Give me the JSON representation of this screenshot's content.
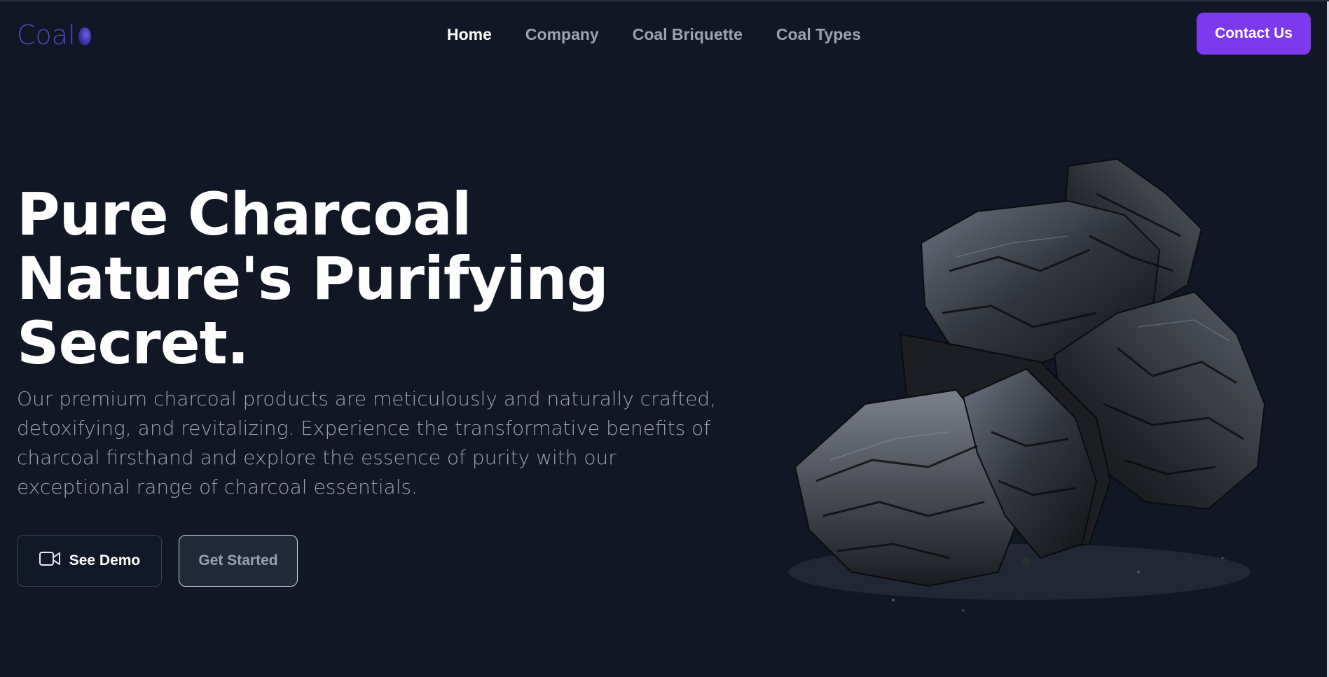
{
  "brand": {
    "name": "Coal",
    "color": "#4f46c8"
  },
  "nav": {
    "items": [
      {
        "label": "Home",
        "active": true
      },
      {
        "label": "Company",
        "active": false
      },
      {
        "label": "Coal Briquette",
        "active": false
      },
      {
        "label": "Coal Types",
        "active": false
      }
    ],
    "contact_label": "Contact Us",
    "contact_color": "#7c3aed"
  },
  "hero": {
    "title_lines": [
      "Pure Charcoal",
      "Nature's Purifying",
      "Secret."
    ],
    "description": "Our premium charcoal products are meticulously and naturally crafted, detoxifying, and revitalizing. Experience the transformative benefits of charcoal firsthand and explore the essence of purity with our exceptional range of charcoal essentials.",
    "demo_button": {
      "label": "See Demo",
      "icon": "video-camera-icon"
    },
    "start_button": {
      "label": "Get Started"
    },
    "image": {
      "subject": "charcoal-chunks"
    }
  },
  "colors": {
    "background": "#121726",
    "text_muted": "#9ca3af"
  }
}
